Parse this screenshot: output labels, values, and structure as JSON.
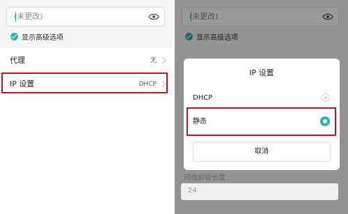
{
  "left": {
    "password_value": "(未更改)",
    "show_advanced_label": "显示高级选项",
    "rows": [
      {
        "label": "代理",
        "value": "无"
      },
      {
        "label": "IP 设置",
        "value": "DHCP"
      }
    ]
  },
  "right": {
    "password_value": "(未更改)",
    "show_advanced_label": "显示高级选项",
    "dialog": {
      "title": "IP 设置",
      "options": [
        {
          "label": "DHCP",
          "selected": false
        },
        {
          "label": "静态",
          "selected": true
        }
      ],
      "cancel_label": "取消"
    },
    "prefix_label": "网络前缀长度",
    "prefix_value": "24"
  },
  "colors": {
    "accent": "#2bb5a8",
    "highlight": "#c0121f"
  },
  "icons": [
    "eye-icon",
    "check-icon",
    "chevron-right-icon",
    "radio-icon"
  ]
}
